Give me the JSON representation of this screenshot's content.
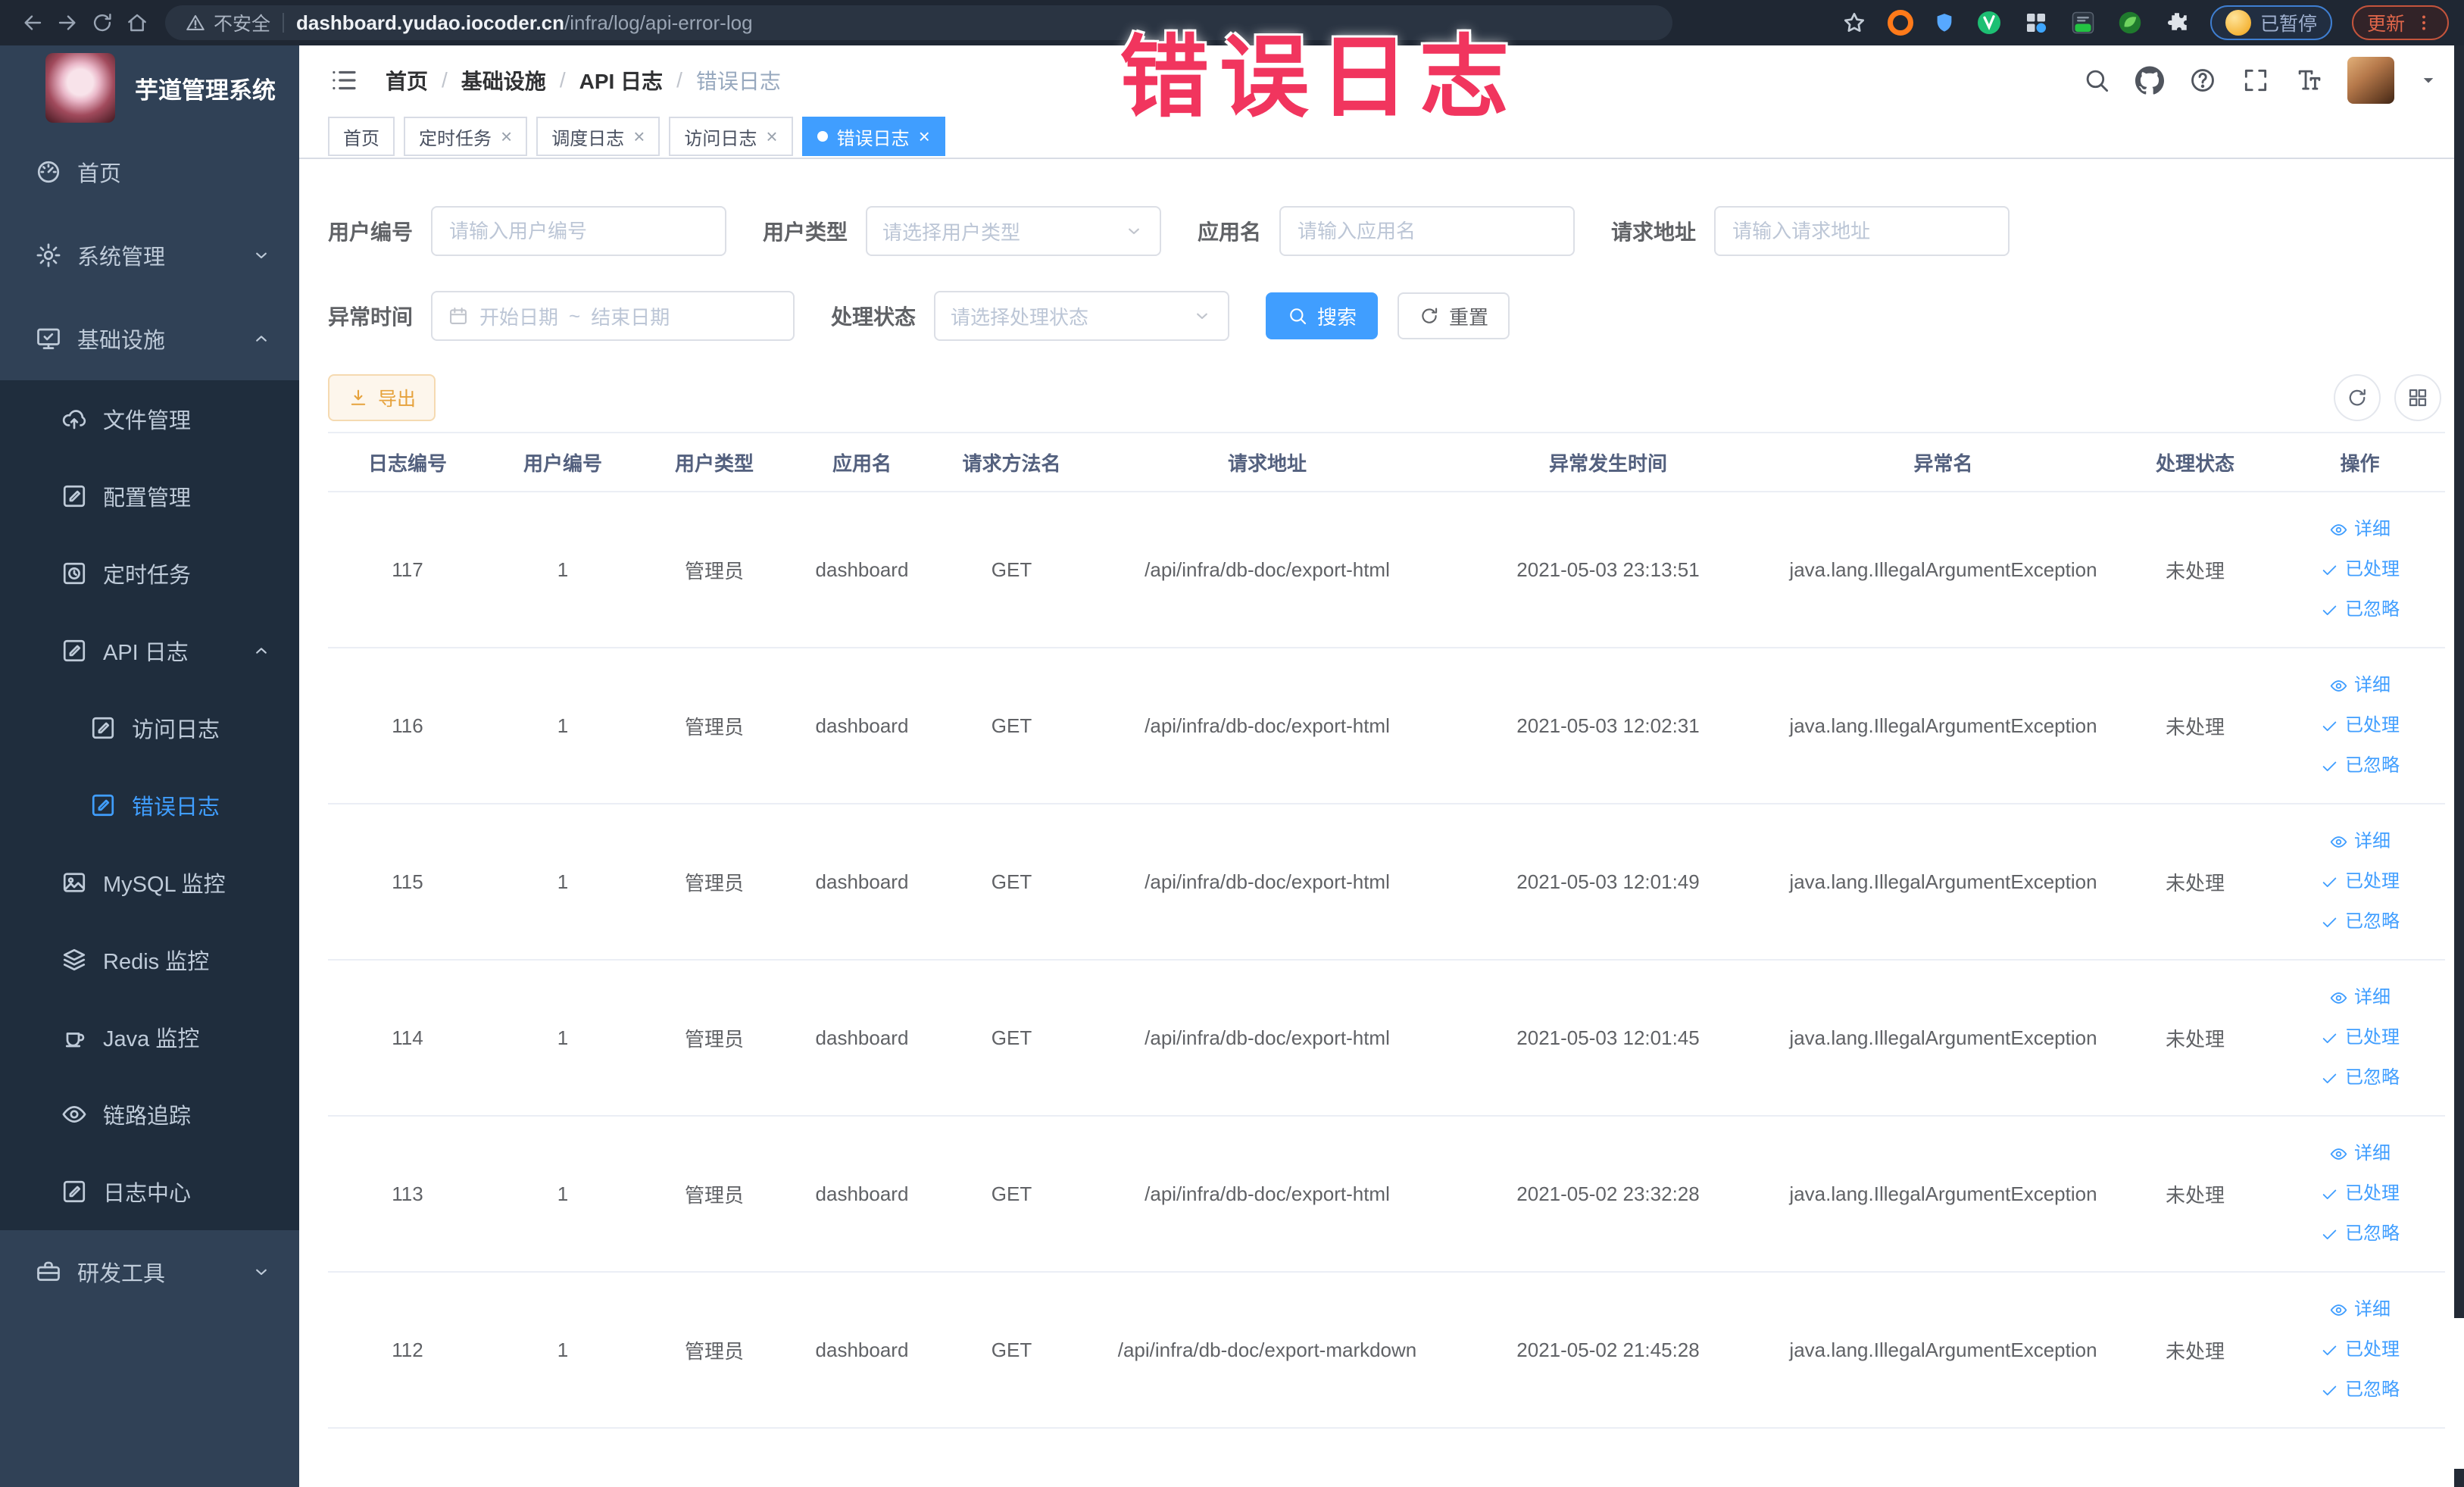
{
  "watermark": {
    "text": "错误日志"
  },
  "browser": {
    "security_label": "不安全",
    "url_host": "dashboard.yudao.iocoder.cn",
    "url_path": "/infra/log/api-error-log",
    "paused_badge": "已暂停",
    "update_badge": "更新"
  },
  "sidebar": {
    "title": "芋道管理系统",
    "items": [
      {
        "label": "首页",
        "icon": "dashboard-icon",
        "level": 0,
        "submenu": false,
        "active": false,
        "chevron": ""
      },
      {
        "label": "系统管理",
        "icon": "settings-icon",
        "level": 0,
        "submenu": false,
        "active": false,
        "chevron": "down"
      },
      {
        "label": "基础设施",
        "icon": "infrastructure-icon",
        "level": 0,
        "submenu": false,
        "active": false,
        "chevron": "up"
      },
      {
        "label": "文件管理",
        "icon": "file-manager-icon",
        "level": 1,
        "submenu": true,
        "active": false,
        "chevron": ""
      },
      {
        "label": "配置管理",
        "icon": "config-icon",
        "level": 1,
        "submenu": true,
        "active": false,
        "chevron": ""
      },
      {
        "label": "定时任务",
        "icon": "cron-icon",
        "level": 1,
        "submenu": true,
        "active": false,
        "chevron": ""
      },
      {
        "label": "API 日志",
        "icon": "api-log-icon",
        "level": 1,
        "submenu": true,
        "active": false,
        "chevron": "up"
      },
      {
        "label": "访问日志",
        "icon": "access-log-icon",
        "level": 2,
        "submenu": true,
        "active": false,
        "chevron": ""
      },
      {
        "label": "错误日志",
        "icon": "error-log-icon",
        "level": 2,
        "submenu": true,
        "active": true,
        "chevron": ""
      },
      {
        "label": "MySQL 监控",
        "icon": "mysql-icon",
        "level": 1,
        "submenu": true,
        "active": false,
        "chevron": ""
      },
      {
        "label": "Redis 监控",
        "icon": "redis-icon",
        "level": 1,
        "submenu": true,
        "active": false,
        "chevron": ""
      },
      {
        "label": "Java 监控",
        "icon": "java-icon",
        "level": 1,
        "submenu": true,
        "active": false,
        "chevron": ""
      },
      {
        "label": "链路追踪",
        "icon": "tracing-icon",
        "level": 1,
        "submenu": true,
        "active": false,
        "chevron": ""
      },
      {
        "label": "日志中心",
        "icon": "log-center-icon",
        "level": 1,
        "submenu": true,
        "active": false,
        "chevron": ""
      },
      {
        "label": "研发工具",
        "icon": "devtools-icon",
        "level": 0,
        "submenu": false,
        "active": false,
        "chevron": "down"
      }
    ]
  },
  "breadcrumb": [
    "首页",
    "基础设施",
    "API 日志",
    "错误日志"
  ],
  "tabs": [
    {
      "label": "首页",
      "closable": false,
      "active": false
    },
    {
      "label": "定时任务",
      "closable": true,
      "active": false
    },
    {
      "label": "调度日志",
      "closable": true,
      "active": false
    },
    {
      "label": "访问日志",
      "closable": true,
      "active": false
    },
    {
      "label": "错误日志",
      "closable": true,
      "active": true
    }
  ],
  "filters": {
    "user_id": {
      "label": "用户编号",
      "placeholder": "请输入用户编号"
    },
    "user_type": {
      "label": "用户类型",
      "placeholder": "请选择用户类型"
    },
    "app_name": {
      "label": "应用名",
      "placeholder": "请输入应用名"
    },
    "request_url": {
      "label": "请求地址",
      "placeholder": "请输入请求地址"
    },
    "error_time": {
      "label": "异常时间",
      "start_placeholder": "开始日期",
      "separator": "~",
      "end_placeholder": "结束日期"
    },
    "process_status": {
      "label": "处理状态",
      "placeholder": "请选择处理状态"
    },
    "search_button": "搜索",
    "reset_button": "重置"
  },
  "toolbar": {
    "export_button": "导出"
  },
  "table": {
    "columns": [
      "日志编号",
      "用户编号",
      "用户类型",
      "应用名",
      "请求方法名",
      "请求地址",
      "异常发生时间",
      "异常名",
      "处理状态",
      "操作"
    ],
    "action_labels": {
      "detail": "详细",
      "processed": "已处理",
      "ignored": "已忽略"
    },
    "rows": [
      {
        "id": "117",
        "user_id": "1",
        "user_type": "管理员",
        "app": "dashboard",
        "method": "GET",
        "url": "/api/infra/db-doc/export-html",
        "time": "2021-05-03 23:13:51",
        "exception": "java.lang.IllegalArgumentException",
        "status": "未处理"
      },
      {
        "id": "116",
        "user_id": "1",
        "user_type": "管理员",
        "app": "dashboard",
        "method": "GET",
        "url": "/api/infra/db-doc/export-html",
        "time": "2021-05-03 12:02:31",
        "exception": "java.lang.IllegalArgumentException",
        "status": "未处理"
      },
      {
        "id": "115",
        "user_id": "1",
        "user_type": "管理员",
        "app": "dashboard",
        "method": "GET",
        "url": "/api/infra/db-doc/export-html",
        "time": "2021-05-03 12:01:49",
        "exception": "java.lang.IllegalArgumentException",
        "status": "未处理"
      },
      {
        "id": "114",
        "user_id": "1",
        "user_type": "管理员",
        "app": "dashboard",
        "method": "GET",
        "url": "/api/infra/db-doc/export-html",
        "time": "2021-05-03 12:01:45",
        "exception": "java.lang.IllegalArgumentException",
        "status": "未处理"
      },
      {
        "id": "113",
        "user_id": "1",
        "user_type": "管理员",
        "app": "dashboard",
        "method": "GET",
        "url": "/api/infra/db-doc/export-html",
        "time": "2021-05-02 23:32:28",
        "exception": "java.lang.IllegalArgumentException",
        "status": "未处理"
      },
      {
        "id": "112",
        "user_id": "1",
        "user_type": "管理员",
        "app": "dashboard",
        "method": "GET",
        "url": "/api/infra/db-doc/export-markdown",
        "time": "2021-05-02 21:45:28",
        "exception": "java.lang.IllegalArgumentException",
        "status": "未处理"
      }
    ]
  },
  "colors": {
    "accent": "#409eff",
    "sidebar_bg": "#304156",
    "submenu_bg": "#1f2d3d",
    "warning": "#e6a23c",
    "watermark": "#f1355e"
  }
}
